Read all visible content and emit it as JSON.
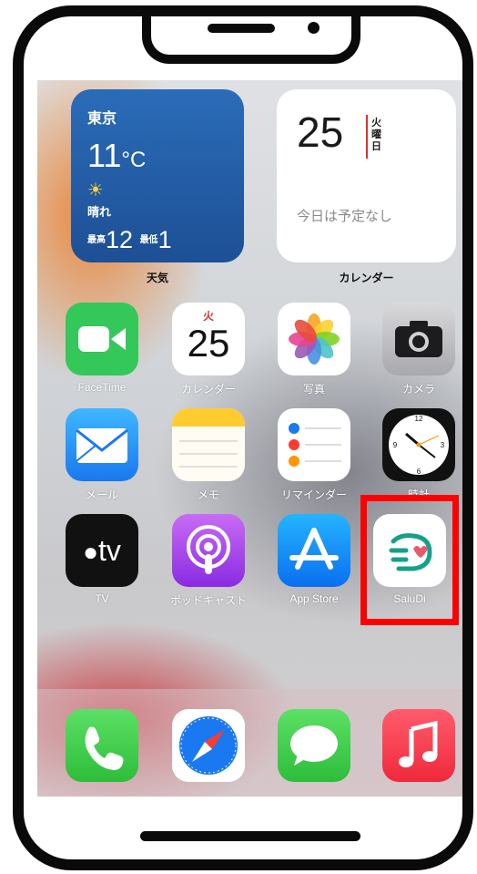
{
  "weather_widget": {
    "city": "東京",
    "temp": "11",
    "unit": "°C",
    "condition": "晴れ",
    "high_label": "最高",
    "high": "12",
    "low_label": "最低",
    "low": "1",
    "label": "天気"
  },
  "calendar_widget": {
    "day": "25",
    "weekday": "火曜日",
    "weekday_lines": [
      "火",
      "曜",
      "日"
    ],
    "events": "今日は予定なし",
    "label": "カレンダー"
  },
  "apps_row1": [
    {
      "label": "FaceTime"
    },
    {
      "label": "カレンダー",
      "weekday": "火",
      "day": "25"
    },
    {
      "label": "写真"
    },
    {
      "label": "カメラ"
    }
  ],
  "apps_row2": [
    {
      "label": "メール"
    },
    {
      "label": "メモ"
    },
    {
      "label": "リマインダー"
    },
    {
      "label": "時計"
    }
  ],
  "apps_row3": [
    {
      "label": "TV",
      "icon_text": "tv"
    },
    {
      "label": "ポッドキャスト"
    },
    {
      "label": "App Store"
    },
    {
      "label": "SaluDi"
    }
  ],
  "dock": [
    {
      "name": "phone-icon"
    },
    {
      "name": "safari-icon"
    },
    {
      "name": "messages-icon"
    },
    {
      "name": "music-icon"
    }
  ],
  "highlight": {
    "target": "SaluDi",
    "color": "#ff0000"
  }
}
